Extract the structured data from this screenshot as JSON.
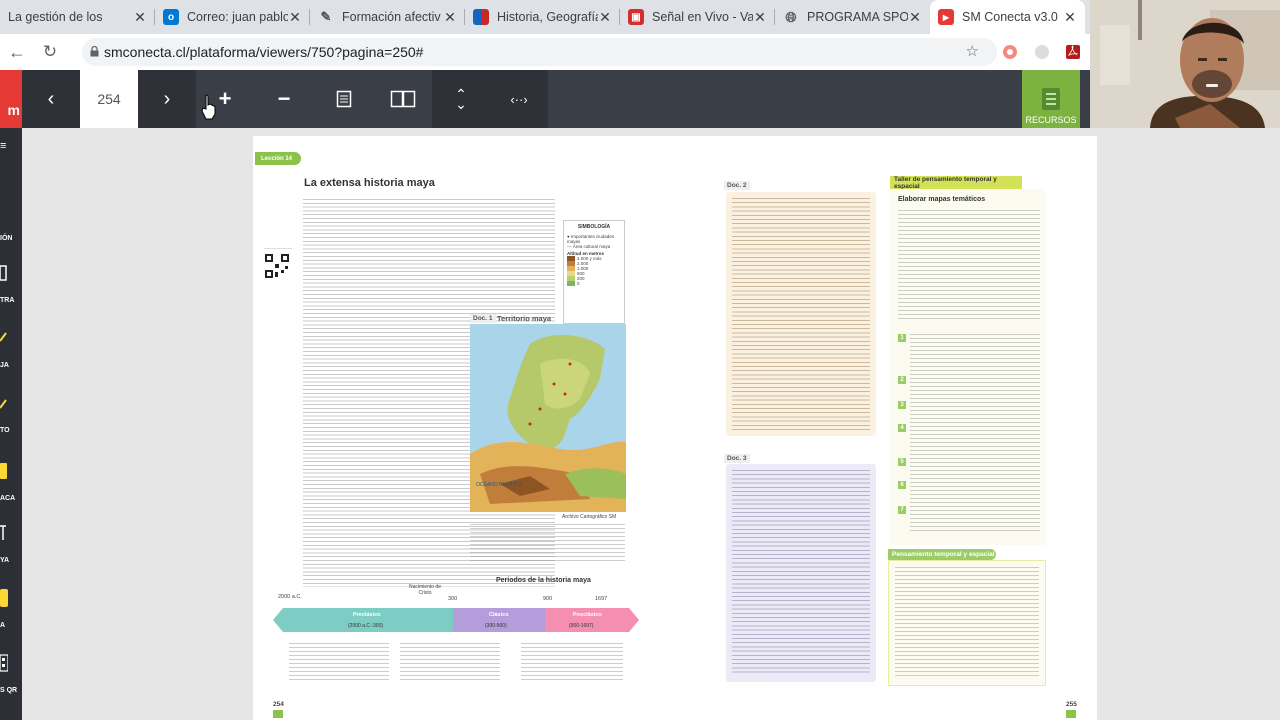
{
  "browser": {
    "tabs": [
      {
        "title": "La gestión de los",
        "favicon_color": "#e5e7eb",
        "active": false
      },
      {
        "title": "Correo: juan pablo",
        "favicon_color": "#0078d4",
        "active": false
      },
      {
        "title": "Formación afectiv",
        "favicon_color": "#555555",
        "active": false
      },
      {
        "title": "Historia, Geografía",
        "favicon_color": "#c62828",
        "active": false
      },
      {
        "title": "Señal en Vivo - Va",
        "favicon_color": "#d32f2f",
        "active": false
      },
      {
        "title": "PROGRAMA SPOR",
        "favicon_color": "#5f6368",
        "active": false
      },
      {
        "title": "SM Conecta v3.0",
        "favicon_color": "#e53935",
        "active": true
      }
    ],
    "url": "smconecta.cl/plataforma/viewers/750?pagina=250#"
  },
  "viewer": {
    "page_number": "254",
    "resources_label": "RECURSOS",
    "logo": "m"
  },
  "sidebar": {
    "items": [
      {
        "label": "IÓN"
      },
      {
        "label": "TRA"
      },
      {
        "label": "JA"
      },
      {
        "label": "TO"
      },
      {
        "label": "ACA"
      },
      {
        "label": "YA"
      },
      {
        "label": "A"
      },
      {
        "label": "S QR"
      }
    ]
  },
  "book": {
    "left": {
      "lesson_tag": "Lección 14",
      "title": "La extensa historia maya",
      "map_doc": "Doc. 1",
      "map_title": "Territorio maya",
      "legend_title": "SIMBOLOGÍA",
      "legend_altitude": "Altitud en metros",
      "legend_items": [
        "Importantes ciudades mayas",
        "Área cultural maya",
        "4.000 y más",
        "2.000",
        "1.000",
        "500",
        "200",
        "0"
      ],
      "map_credit": "Archivo Cartográfico SM",
      "ocean_label": "OCÉANO PACÍFICO",
      "timeline_title": "Períodos de la historia maya",
      "timeline_birth": "Nacimiento de Cristo",
      "timeline_years": [
        "2000 a.C.",
        "300",
        "900",
        "1697"
      ],
      "periods": [
        {
          "name": "Preclásico",
          "range": "(2000 a.C.-300)"
        },
        {
          "name": "Clásico",
          "range": "(300-900)"
        },
        {
          "name": "Posclásico",
          "range": "(900-1697)"
        }
      ],
      "page_number": "254"
    },
    "right": {
      "doc2": "Doc. 2",
      "doc3": "Doc. 3",
      "workshop": "Taller de pensamiento temporal y espacial",
      "workshop_title": "Elaborar mapas temáticos",
      "steps": [
        "1",
        "2",
        "3",
        "4",
        "5",
        "6",
        "7"
      ],
      "section2": "Pensamiento temporal y espacial",
      "page_number": "255"
    }
  }
}
